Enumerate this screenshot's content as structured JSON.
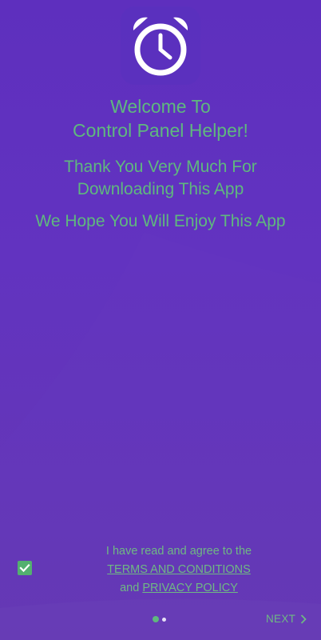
{
  "colors": {
    "background": "#5e2fbe",
    "accent_green": "#5fb87e",
    "logo_white": "#ffffff"
  },
  "logo": {
    "icon": "alarm-clock-icon"
  },
  "welcome": {
    "line1": "Welcome To",
    "line2": "Control Panel Helper!"
  },
  "thanks": {
    "line1": "Thank You Very Much For",
    "line2": "Downloading This App"
  },
  "hope": "We Hope You Will Enjoy This App",
  "agreement": {
    "checked": true,
    "line1": "I have read and agree to the",
    "terms_link": "TERMS AND CONDITIONS",
    "and_text": "and",
    "privacy_link": "PRIVACY POLICY"
  },
  "pager": {
    "current_page": 1,
    "total_pages": 2
  },
  "next_button": {
    "label": "NEXT",
    "icon": "chevron-right-icon"
  }
}
